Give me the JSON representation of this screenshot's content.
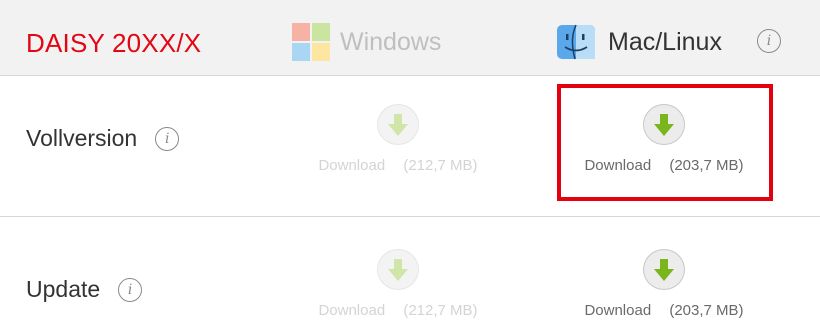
{
  "header": {
    "product_title": "DAISY 20XX/X",
    "platforms": [
      {
        "label": "Windows",
        "icon": "windows-logo-icon",
        "state": "disabled"
      },
      {
        "label": "Mac/Linux",
        "icon": "finder-icon",
        "state": "enabled"
      }
    ],
    "info_glyph": "i"
  },
  "rows": [
    {
      "label": "Vollversion",
      "downloads": [
        {
          "label": "Download",
          "size": "(212,7 MB)",
          "state": "disabled"
        },
        {
          "label": "Download",
          "size": "(203,7 MB)",
          "state": "enabled",
          "highlighted": true
        }
      ]
    },
    {
      "label": "Update",
      "downloads": [
        {
          "label": "Download",
          "size": "(212,7 MB)",
          "state": "disabled"
        },
        {
          "label": "Download",
          "size": "(203,7 MB)",
          "state": "enabled"
        }
      ]
    }
  ],
  "colors": {
    "brand_red": "#e30613",
    "download_green": "#7ab51d",
    "download_green_disabled": "#cfe6a8",
    "highlight_red": "#e3000f"
  }
}
